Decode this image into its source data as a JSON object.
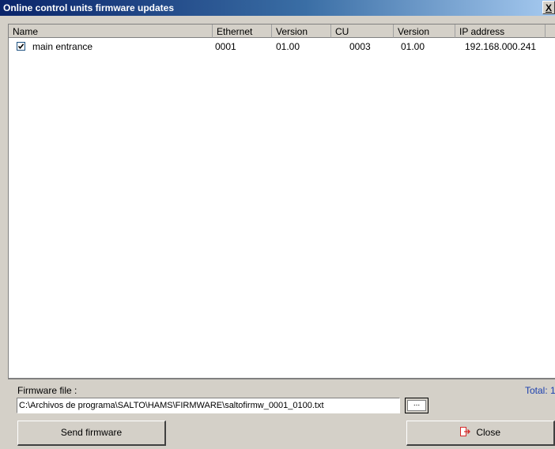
{
  "window": {
    "title": "Online control units firmware updates",
    "close_glyph": "X"
  },
  "list": {
    "columns": [
      "Name",
      "Ethernet",
      "Version",
      "CU",
      "Version",
      "IP address"
    ],
    "rows": [
      {
        "checked": true,
        "name": "main entrance",
        "ethernet": "0001",
        "eth_version": "01.00",
        "cu": "0003",
        "cu_version": "01.00",
        "ip": "192.168.000.241"
      }
    ]
  },
  "firmware": {
    "label": "Firmware file :",
    "path": "C:\\Archivos de programa\\SALTO\\HAMS\\FIRMWARE\\saltofirmw_0001_0100.txt",
    "browse_label": "...",
    "total": "Total: 1"
  },
  "buttons": {
    "send": "Send firmware",
    "close": "Close"
  },
  "colors": {
    "title_start": "#0a246a",
    "title_end": "#a6caf0",
    "total_text": "#1b3fae",
    "close_icon": "#d62828"
  },
  "icons": {
    "checkbox": "check-icon",
    "close_button": "exit-door-icon"
  }
}
